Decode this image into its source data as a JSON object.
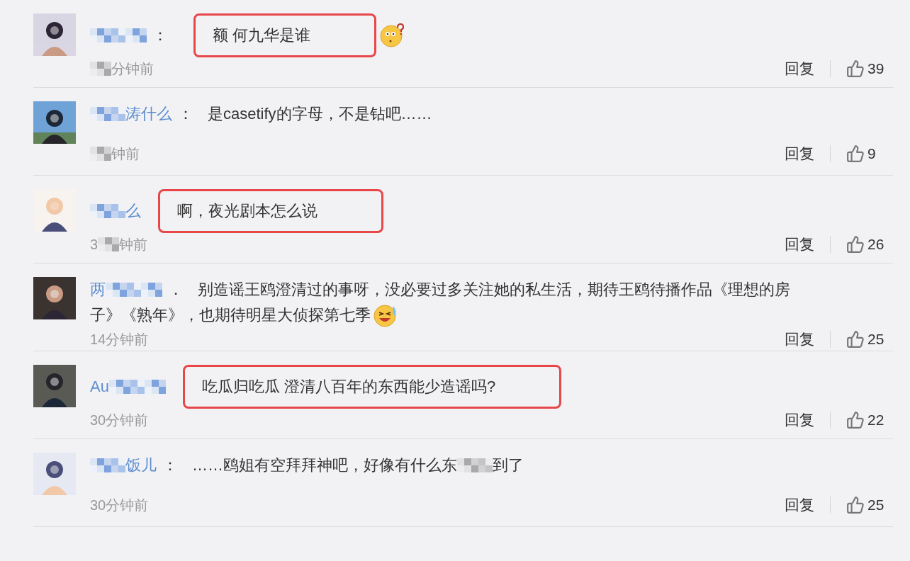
{
  "comments": [
    {
      "user": {
        "blurred": true
      },
      "separator": "：",
      "lines": [
        "额 何九华是谁"
      ],
      "emoji": {
        "kind": "puzzled"
      },
      "highlighted": true,
      "time": {
        "blurred": true,
        "after": "分钟前"
      },
      "reply": "回复",
      "likes": "39"
    },
    {
      "user": {
        "blurred": true,
        "after": "涛什么"
      },
      "separator": "：",
      "lines": [
        "是casetify的字母，不是钻吧……"
      ],
      "highlighted": false,
      "time": {
        "blurred": true,
        "after": "钟前"
      },
      "reply": "回复",
      "likes": "9"
    },
    {
      "user": {
        "blurred": true,
        "after": "么"
      },
      "lines": [
        "啊，夜光剧本怎么说"
      ],
      "highlighted": true,
      "time": {
        "before": "3",
        "blurred": true,
        "after": "钟前"
      },
      "reply": "回复",
      "likes": "26"
    },
    {
      "user": {
        "before": "两",
        "blurred": true
      },
      "separator": "．",
      "lines": [
        "别造谣王鸥澄清过的事呀，没必要过多关注她的私生活，期待王鸥待播作品《理想的房",
        "子》《熟年》，也期待明星大侦探第七季"
      ],
      "emoji": {
        "kind": "laugh-cry"
      },
      "highlighted": false,
      "time": {
        "before": "14分钟前"
      },
      "reply": "回复",
      "likes": "25"
    },
    {
      "user": {
        "before": "Au",
        "blurred": true
      },
      "lines": [
        "吃瓜归吃瓜 澄清八百年的东西能少造谣吗?"
      ],
      "highlighted": true,
      "time": {
        "before": "30分钟前"
      },
      "reply": "回复",
      "likes": "22"
    },
    {
      "user": {
        "blurred": true,
        "after": "饭儿"
      },
      "separator": "：",
      "lines": [
        "……鸥姐有空拜拜神吧，好像有什么东"
      ],
      "text_after_blur": "到了",
      "highlighted": false,
      "time": {
        "before": "30分钟前"
      },
      "reply": "回复",
      "likes": "25"
    }
  ]
}
